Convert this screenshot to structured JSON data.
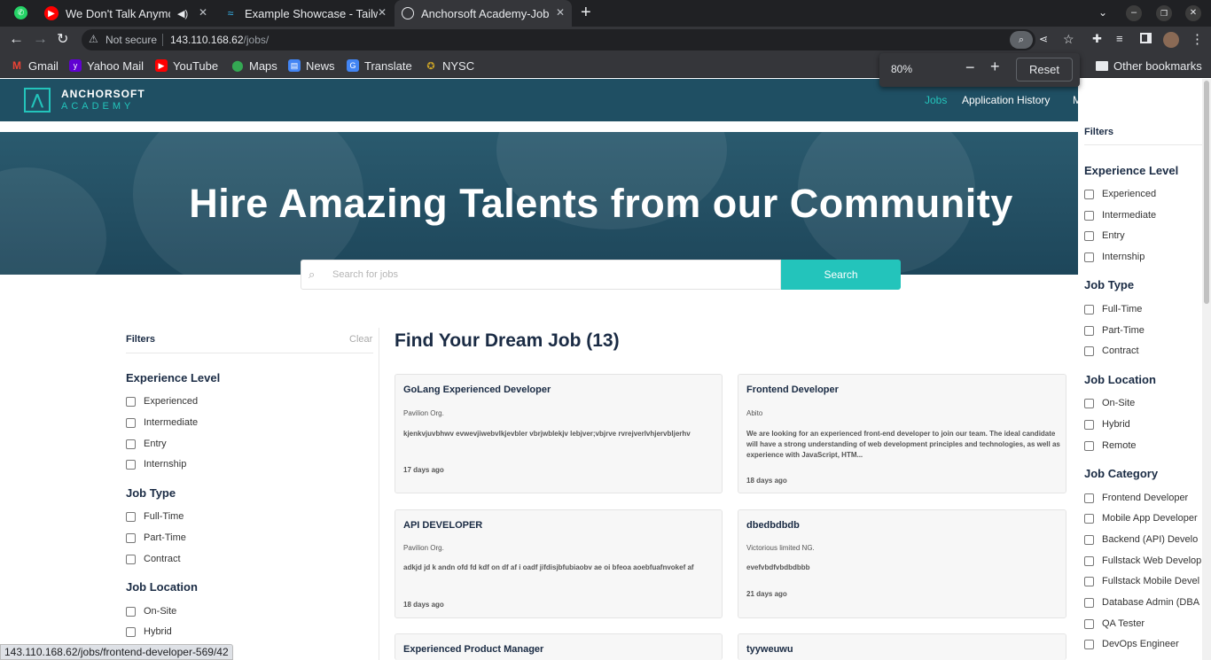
{
  "browser": {
    "tabs": [
      {
        "title": "We Don't Talk Anymor",
        "icon": "youtube-icon"
      },
      {
        "title": "Example Showcase - Tailw",
        "icon": "tailwind-icon"
      },
      {
        "title": "Anchorsoft Academy-Job",
        "icon": "globe-icon"
      }
    ],
    "url_warning": "Not secure",
    "url_host": "143.110.168.62",
    "url_path": "/jobs/",
    "bookmarks": [
      "Gmail",
      "Yahoo Mail",
      "YouTube",
      "Maps",
      "News",
      "Translate",
      "NYSC"
    ],
    "other_bookmarks": "Other bookmarks",
    "zoom_level": "80%",
    "zoom_reset": "Reset",
    "status_url": "143.110.168.62/jobs/frontend-developer-569/42"
  },
  "site": {
    "logo_top": "ANCHORSOFT",
    "logo_bottom": "ACADEMY",
    "nav": [
      "Jobs",
      "Application History",
      "M"
    ],
    "hero_title": "Hire Amazing Talents from our Community",
    "search_placeholder": "Search for jobs",
    "search_button": "Search"
  },
  "filters": {
    "title": "Filters",
    "clear": "Clear",
    "experience_title": "Experience Level",
    "experience": [
      "Experienced",
      "Intermediate",
      "Entry",
      "Internship"
    ],
    "type_title": "Job Type",
    "types": [
      "Full-Time",
      "Part-Time",
      "Contract"
    ],
    "location_title": "Job Location",
    "locations": [
      "On-Site",
      "Hybrid",
      "Remote"
    ],
    "category_title": "Job Category",
    "categories": [
      "Frontend Developer",
      "Mobile App Developer",
      "Backend (API) Develo",
      "Fullstack Web Develop",
      "Fullstack Mobile Devel",
      "Database Admin (DBA",
      "QA Tester",
      "DevOps Engineer"
    ]
  },
  "jobs": {
    "heading": "Find Your Dream Job (13)",
    "cards": [
      {
        "title": "GoLang Experienced Developer",
        "company": "Pavilion Org.",
        "desc": "kjenkvjuvbhwv evwevjiwebvlkjevbler vbrjwblekjv lebjver;vbjrve rvrejverlvhjervbljerhv",
        "age": "17 days ago"
      },
      {
        "title": "Frontend Developer",
        "company": "Abito",
        "desc": "We are looking for an experienced front-end developer to join our team. The ideal candidate will have a strong understanding of web development principles and technologies, as well as experience with JavaScript, HTM...",
        "age": "18 days ago"
      },
      {
        "title": "API DEVELOPER",
        "company": "Pavilion Org.",
        "desc": "adkjd jd k andn ofd fd kdf on df af i oadf jifdisjbfubiaobv ae oi bfeoa aoebfuafnvokef af",
        "age": "18 days ago"
      },
      {
        "title": "dbedbdbdb",
        "company": "Victorious limited NG.",
        "desc": "evefvbdfvbdbdbbb",
        "age": "21 days ago"
      },
      {
        "title": "Experienced Product Manager",
        "company": "",
        "desc": "",
        "age": ""
      },
      {
        "title": "tyyweuwu",
        "company": "",
        "desc": "",
        "age": ""
      }
    ]
  },
  "colors": {
    "header": "#1f4f63",
    "accent": "#23c4bb",
    "navy": "#1a2b44"
  }
}
